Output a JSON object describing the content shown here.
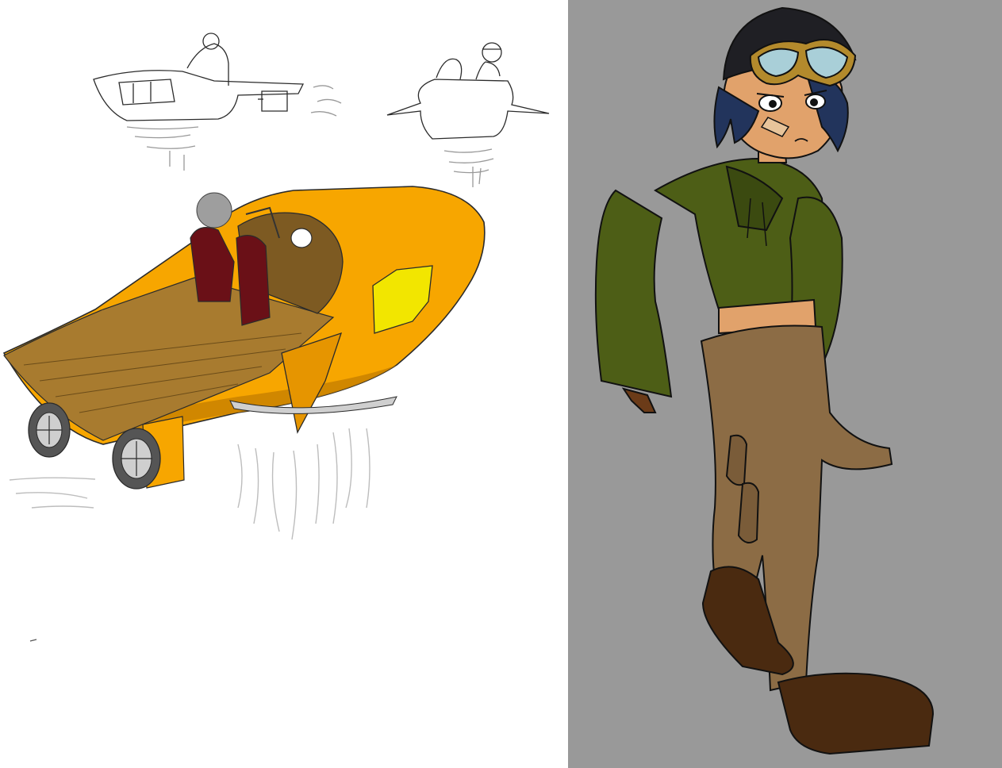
{
  "canvas": {
    "background": "#ffffff"
  },
  "left_panel": {
    "background": "#ffffff",
    "subject": "hovercraft-concept-sketches",
    "colors": {
      "hull": "#f7a600",
      "deck": "#a87b2f",
      "seat": "#6a1017",
      "window": "#f2e600",
      "sketch_line": "#2b2b2b",
      "mist": "#b8b8b8"
    }
  },
  "right_panel": {
    "background": "#999999",
    "subject": "pilot-character-design",
    "colors": {
      "hoodie": "#4d5e16",
      "hoodie_shade": "#3b4a10",
      "pants": "#8c6c45",
      "boots": "#4a2a10",
      "skin": "#e1a26b",
      "hair": "#22345c",
      "helmet": "#1f1f24",
      "goggle_frame": "#b38a2c",
      "goggle_lens": "#a9cfd8"
    }
  }
}
